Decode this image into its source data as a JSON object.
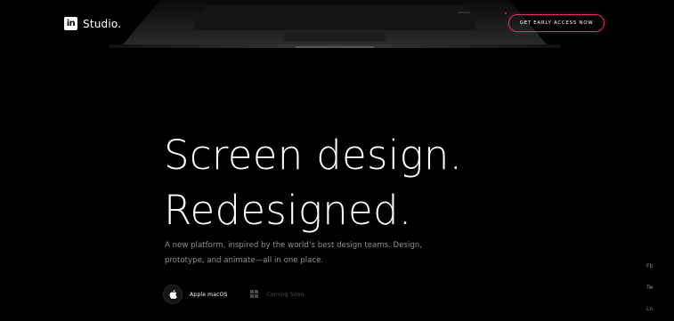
{
  "header": {
    "logo_mark": "in",
    "logo_text": "Studio.",
    "cta_label": "GET EARLY ACCESS NOW"
  },
  "hero": {
    "headline_line1": "Screen design.",
    "headline_line2": "Redesigned.",
    "subtext": "A new platform, inspired by the world’s best design teams. Design, prototype, and animate—all in one place."
  },
  "platforms": {
    "mac_label": "Apple macOS",
    "windows_label": "Coming Soon"
  },
  "social": {
    "fb": "Fb",
    "tw": "Tw",
    "ln": "Ln"
  },
  "colors": {
    "background": "#000000",
    "accent": "#e0306a",
    "subtext": "#8d8d94"
  },
  "icons": [
    "laptop-image",
    "apple-icon",
    "windows-icon"
  ]
}
